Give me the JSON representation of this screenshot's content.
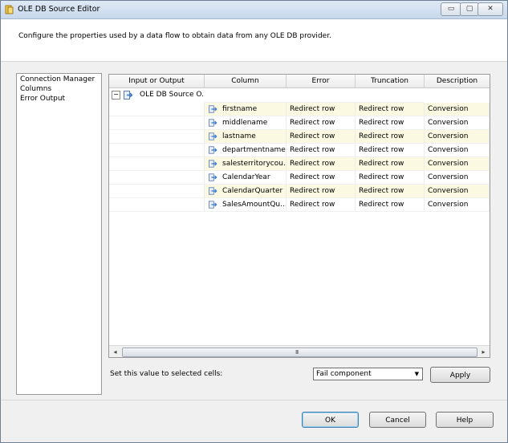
{
  "window": {
    "title": "OLE DB Source Editor",
    "icon": "ssis-source-editor-icon",
    "caption_buttons": {
      "minimize": "▭",
      "maximize": "▢",
      "close": "✕"
    }
  },
  "header": {
    "text": "Configure the properties used by a data flow to obtain data from any OLE DB provider."
  },
  "nav": {
    "items": [
      {
        "label": "Connection Manager"
      },
      {
        "label": "Columns"
      },
      {
        "label": "Error Output"
      }
    ]
  },
  "grid": {
    "headers": {
      "input_or_output": "Input or Output",
      "column": "Column",
      "error": "Error",
      "truncation": "Truncation",
      "description": "Description"
    },
    "group": {
      "expander": "−",
      "label": "OLE DB Source O..."
    },
    "rows": [
      {
        "column": "firstname",
        "error": "Redirect row",
        "truncation": "Redirect row",
        "description": "Conversion"
      },
      {
        "column": "middlename",
        "error": "Redirect row",
        "truncation": "Redirect row",
        "description": "Conversion"
      },
      {
        "column": "lastname",
        "error": "Redirect row",
        "truncation": "Redirect row",
        "description": "Conversion"
      },
      {
        "column": "departmentname",
        "error": "Redirect row",
        "truncation": "Redirect row",
        "description": "Conversion"
      },
      {
        "column": "salesterritorycou...",
        "error": "Redirect row",
        "truncation": "Redirect row",
        "description": "Conversion"
      },
      {
        "column": "CalendarYear",
        "error": "Redirect row",
        "truncation": "Redirect row",
        "description": "Conversion"
      },
      {
        "column": "CalendarQuarter",
        "error": "Redirect row",
        "truncation": "Redirect row",
        "description": "Conversion"
      },
      {
        "column": "SalesAmountQu...",
        "error": "Redirect row",
        "truncation": "Redirect row",
        "description": "Conversion"
      }
    ],
    "scrollbar": {
      "left": "◂",
      "right": "▸",
      "grip": "III"
    }
  },
  "bottom": {
    "set_label": "Set this value to selected cells:",
    "selected_value": "Fail component",
    "dropdown_arrow": "▼",
    "apply_label": "Apply"
  },
  "footer": {
    "ok": "OK",
    "cancel": "Cancel",
    "help": "Help"
  },
  "colors": {
    "alt_row": "#fcf9e2",
    "icon_blue": "#3a78c8"
  }
}
